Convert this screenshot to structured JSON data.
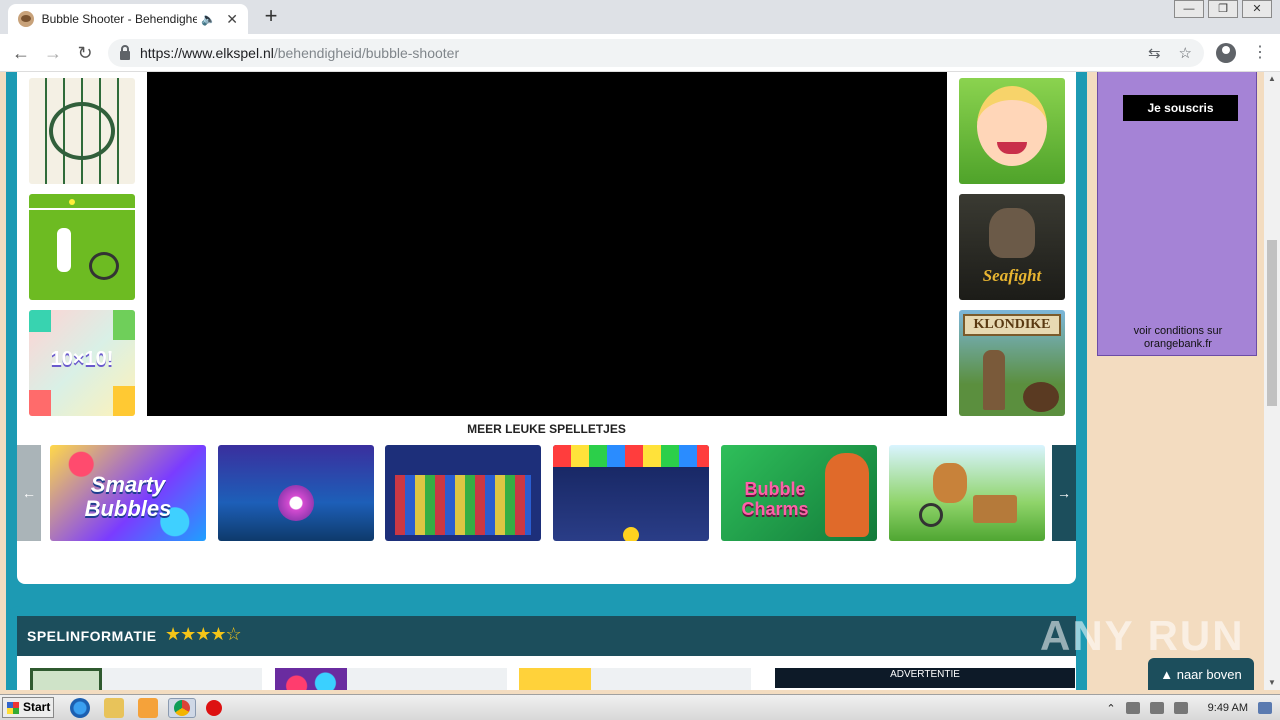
{
  "browser": {
    "tab_title": "Bubble Shooter - Behendigheid",
    "mute_icon": "🔈",
    "close_icon": "✕",
    "new_tab_icon": "+",
    "window_buttons": [
      "—",
      "❐",
      "✕"
    ],
    "back_icon": "←",
    "forward_icon": "→",
    "reload_icon": "↻",
    "url_host": "https://www.elkspel.nl",
    "url_path": "/behendigheid/bubble-shooter",
    "translate_icon": "⇆",
    "star_icon": "☆",
    "menu_icon": "⋮"
  },
  "game": {
    "more_games_title": "MEER LEUKE SPELLETJES",
    "prev_arrow": "←",
    "next_arrow": "→",
    "left_thumbs": [
      "mahjong",
      "tennis",
      "10x10"
    ],
    "left_thumb_texts": [
      "",
      "",
      "10×10!"
    ],
    "right_thumbs": [
      "baby-hazel",
      "seafight",
      "klondike"
    ],
    "right_thumb_texts": [
      "",
      "Seafight",
      "KLONDIKE"
    ],
    "carousel": [
      {
        "name": "smarty-bubbles",
        "text": "Smarty Bubbles"
      },
      {
        "name": "bubble-shooter-space",
        "text": ""
      },
      {
        "name": "bubble-columns",
        "text": ""
      },
      {
        "name": "bubble-classic",
        "text": ""
      },
      {
        "name": "bubble-charms",
        "text": "Bubble Charms"
      },
      {
        "name": "cat-bike",
        "text": ""
      }
    ]
  },
  "info": {
    "title": "SPELINFORMATIE",
    "rating": 3.5,
    "stars_text": "★★★★☆",
    "advertisement_label": "ADVERTENTIE"
  },
  "sidebar_ad": {
    "button_label": "Je souscris",
    "note_line1": "voir conditions sur",
    "note_line2": "orangebank.fr"
  },
  "watermark": "ANY RUN",
  "back_to_top": "▲  naar boven",
  "taskbar": {
    "start_label": "Start",
    "clock": "9:49 AM"
  }
}
